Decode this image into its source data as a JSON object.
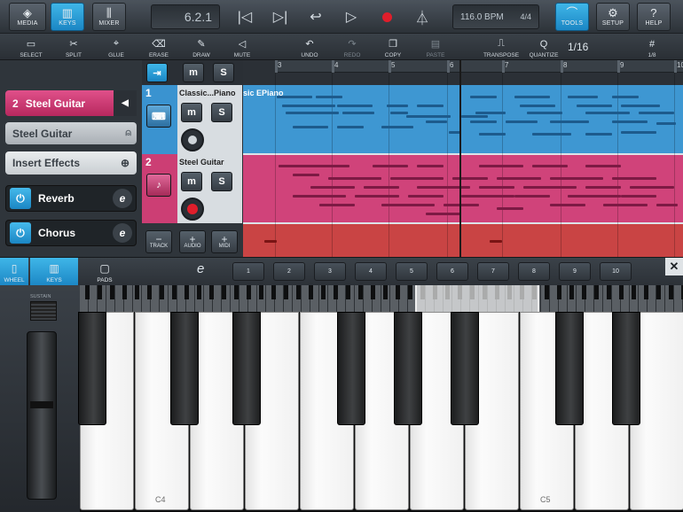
{
  "topbar": {
    "media": "MEDIA",
    "keys": "KEYS",
    "mixer": "MIXER",
    "position": "6.2.1",
    "tempo": "116.0 BPM",
    "signature": "4/4",
    "tools": "TOOLS",
    "setup": "SETUP",
    "help": "HELP"
  },
  "toolbar": {
    "select": "SELECT",
    "split": "SPLIT",
    "glue": "GLUE",
    "erase": "ERASE",
    "draw": "DRAW",
    "mute": "MUTE",
    "undo": "UNDO",
    "redo": "REDO",
    "copy": "COPY",
    "paste": "PASTE",
    "transpose": "TRANSPOSE",
    "quantize": "QUANTIZE",
    "quantize_value": "1/16",
    "grid": "1/8"
  },
  "ruler": [
    "3",
    "4",
    "5",
    "6",
    "7",
    "8",
    "9",
    "10"
  ],
  "left": {
    "selected_track_number": "2",
    "selected_track_name": "Steel Guitar",
    "instrument": "Steel Guitar",
    "insert_effects": "Insert Effects",
    "effects": [
      "Reverb",
      "Chorus"
    ]
  },
  "tracks": [
    {
      "number": "1",
      "name": "Classic...Piano",
      "clip_name": "sic EPiano",
      "color": "#3a93d0"
    },
    {
      "number": "2",
      "name": "Steel Guitar",
      "color": "#cc3e74"
    }
  ],
  "track_buttons": {
    "mute": "m",
    "solo": "S",
    "track": "TRACK",
    "audio": "AUDIO",
    "midi": "MIDI"
  },
  "keyboard": {
    "wheel": "WHEEL",
    "keys": "KEYS",
    "pads": "PADS",
    "edit_icon": "e",
    "octaves": [
      "1",
      "2",
      "3",
      "4",
      "5",
      "6",
      "7",
      "8",
      "9",
      "10"
    ],
    "sustain": "SUSTAIN",
    "c4": "C4",
    "c5": "C5"
  }
}
